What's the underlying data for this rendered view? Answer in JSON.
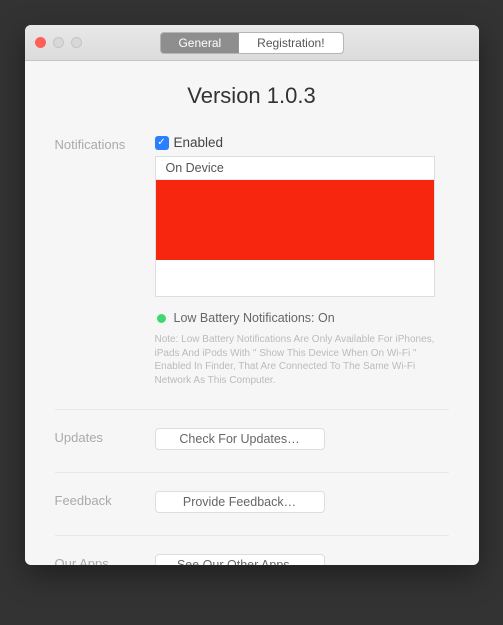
{
  "tabs": {
    "general": "General",
    "registration": "Registration!"
  },
  "version_title": "Version 1.0.3",
  "sections": {
    "notifications": {
      "label": "Notifications",
      "enabled_label": "Enabled",
      "enabled_checked": true,
      "device_header": "On Device",
      "low_battery_label": "Low Battery Notifications: On",
      "note": "Note: Low Battery Notifications Are Only Available For iPhones, iPads And iPods With \" Show This Device When On Wi-Fi \" Enabled In Finder, That Are Connected To The Same Wi-Fi Network As This Computer."
    },
    "updates": {
      "label": "Updates",
      "button": "Check For Updates…"
    },
    "feedback": {
      "label": "Feedback",
      "button": "Provide Feedback…"
    },
    "our_apps": {
      "label": "Our Apps",
      "button": "See Our Other Apps…"
    }
  }
}
